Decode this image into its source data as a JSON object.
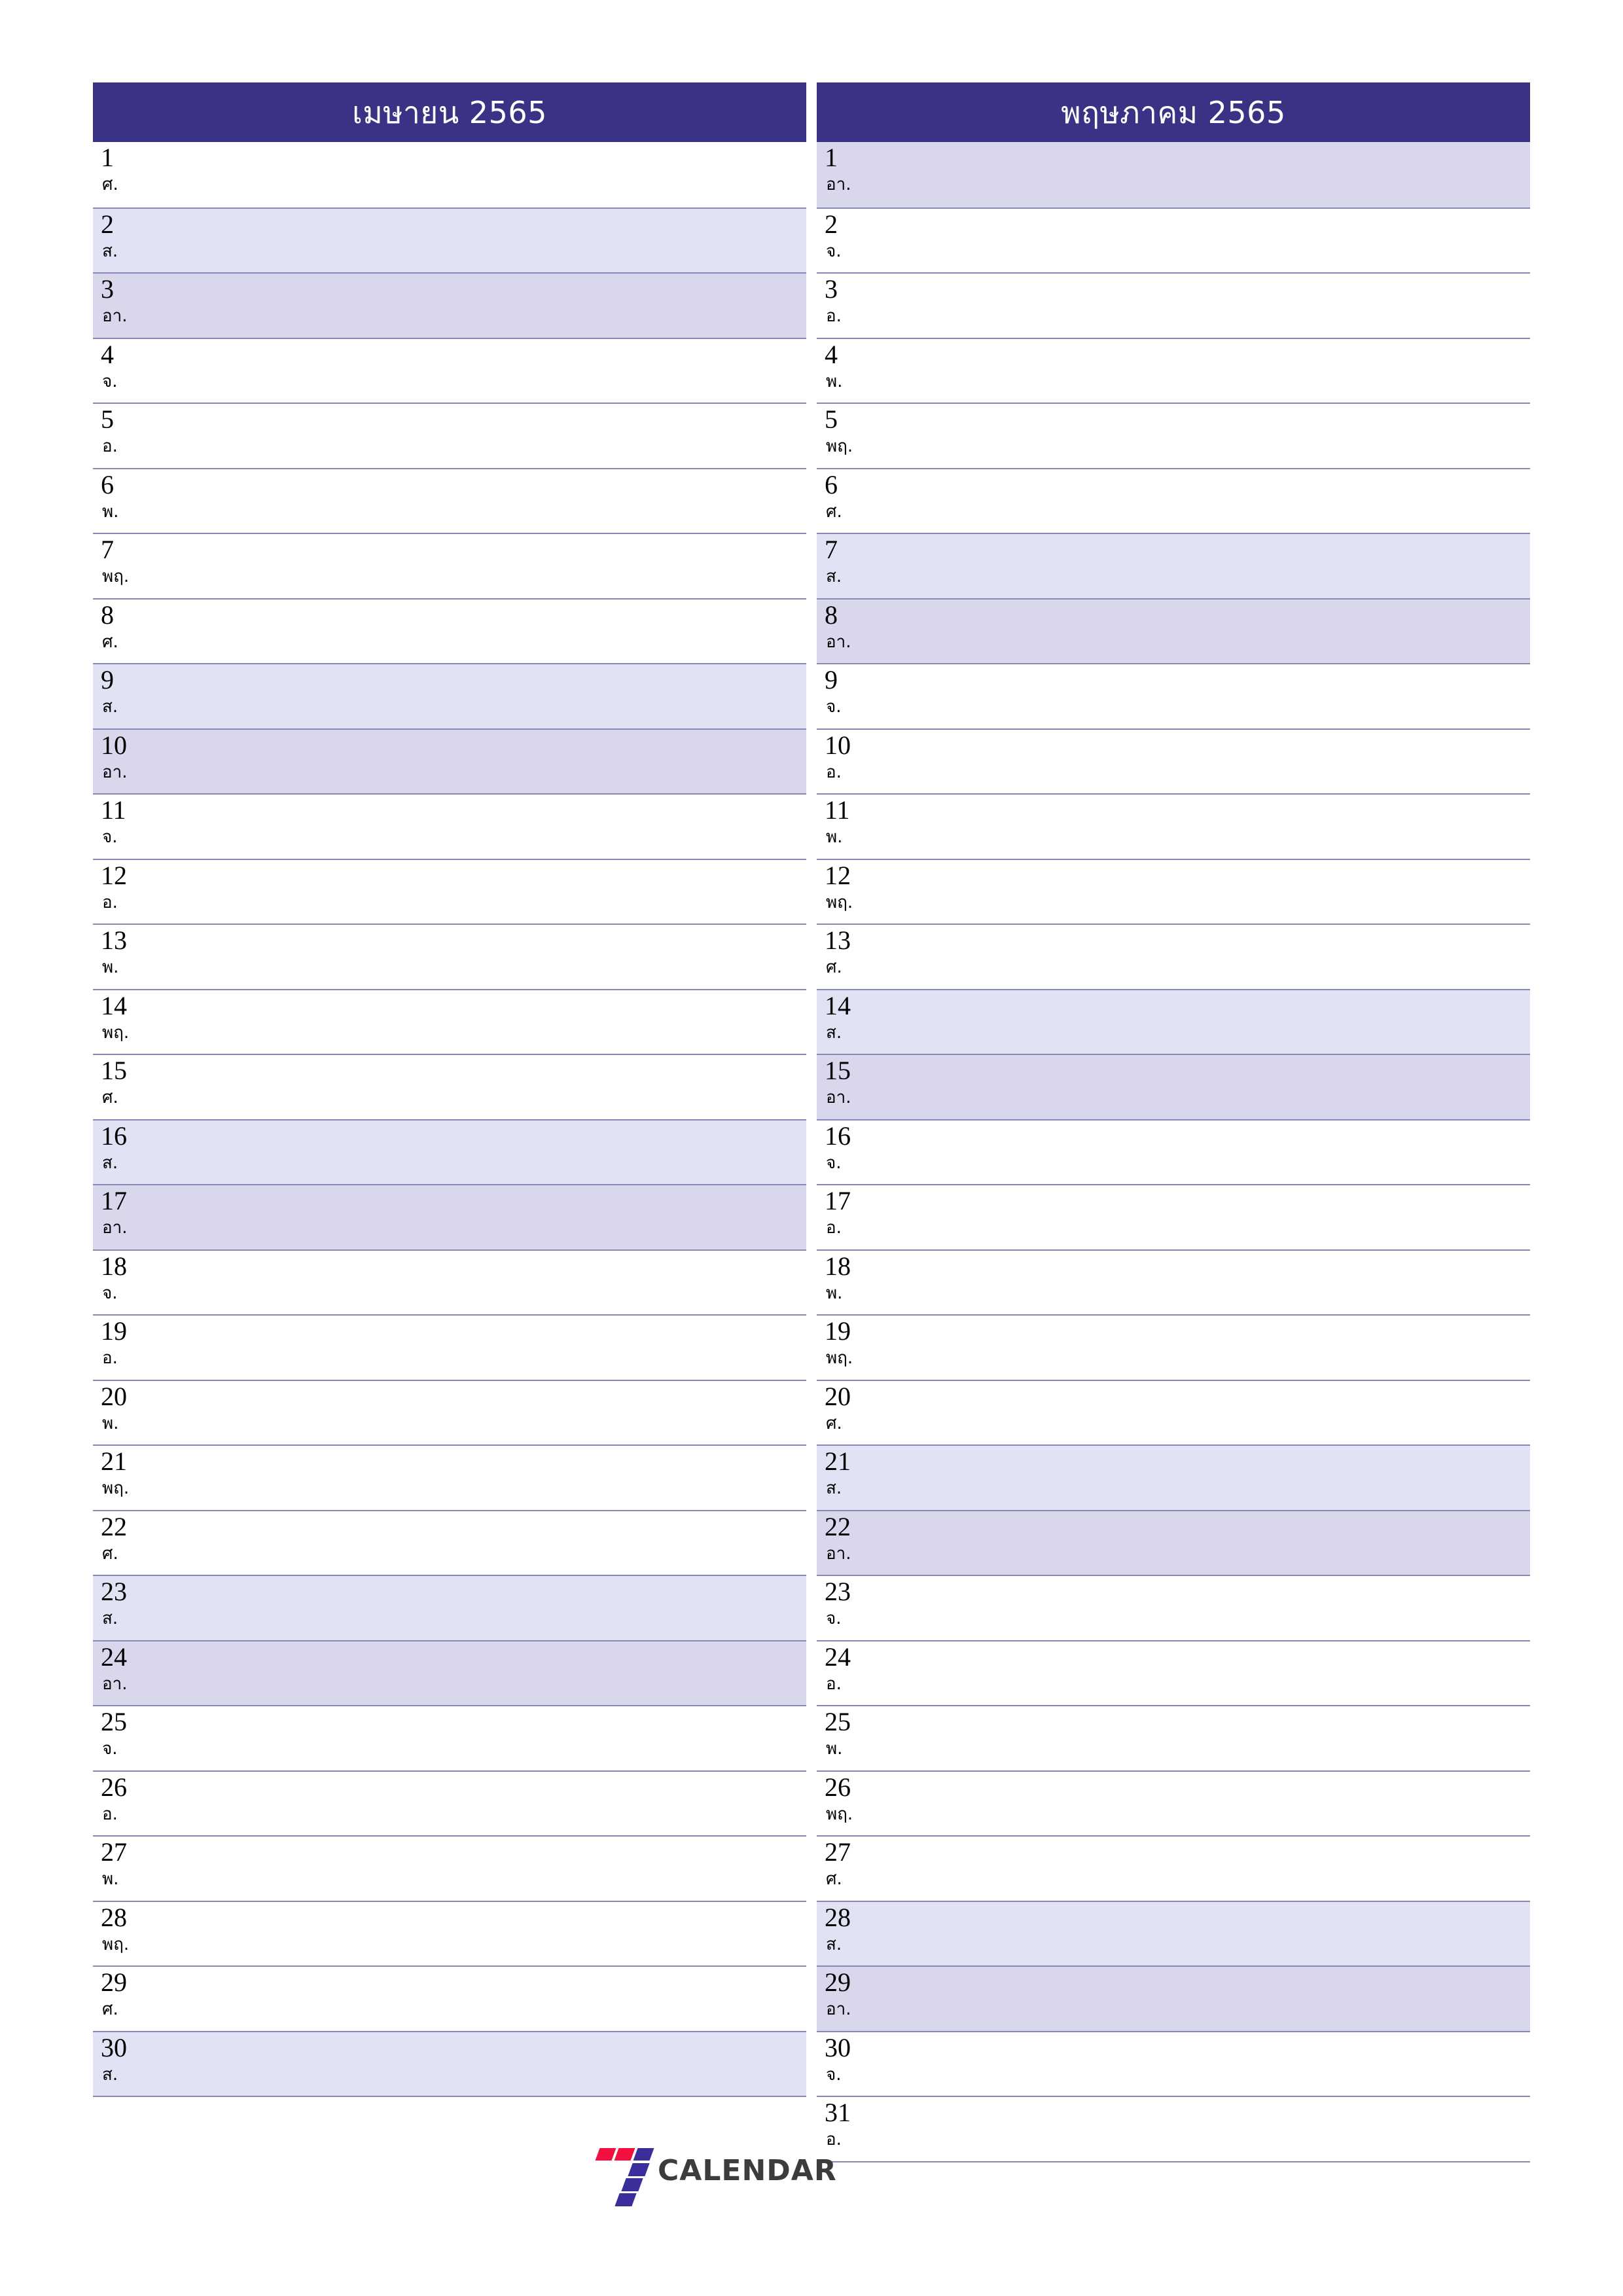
{
  "document": {
    "type": "monthly-planner",
    "orientation": "portrait",
    "colors": {
      "header_background": "#3a3285",
      "header_text": "#ffffff",
      "saturday_row": "#e2e2f5",
      "sunday_row": "#d9d7ec",
      "row_separator": "#8b86b8",
      "page_background": "#ffffff",
      "logo_red": "#f50f3f",
      "logo_purple": "#3a2f9a",
      "logo_text": "#3c3c3c"
    }
  },
  "months": [
    {
      "title": "เมษายน 2565",
      "days": [
        {
          "num": "1",
          "name": "ศ.",
          "type": "weekday"
        },
        {
          "num": "2",
          "name": "ส.",
          "type": "saturday"
        },
        {
          "num": "3",
          "name": "อา.",
          "type": "sunday"
        },
        {
          "num": "4",
          "name": "จ.",
          "type": "weekday"
        },
        {
          "num": "5",
          "name": "อ.",
          "type": "weekday"
        },
        {
          "num": "6",
          "name": "พ.",
          "type": "weekday"
        },
        {
          "num": "7",
          "name": "พฤ.",
          "type": "weekday"
        },
        {
          "num": "8",
          "name": "ศ.",
          "type": "weekday"
        },
        {
          "num": "9",
          "name": "ส.",
          "type": "saturday"
        },
        {
          "num": "10",
          "name": "อา.",
          "type": "sunday"
        },
        {
          "num": "11",
          "name": "จ.",
          "type": "weekday"
        },
        {
          "num": "12",
          "name": "อ.",
          "type": "weekday"
        },
        {
          "num": "13",
          "name": "พ.",
          "type": "weekday"
        },
        {
          "num": "14",
          "name": "พฤ.",
          "type": "weekday"
        },
        {
          "num": "15",
          "name": "ศ.",
          "type": "weekday"
        },
        {
          "num": "16",
          "name": "ส.",
          "type": "saturday"
        },
        {
          "num": "17",
          "name": "อา.",
          "type": "sunday"
        },
        {
          "num": "18",
          "name": "จ.",
          "type": "weekday"
        },
        {
          "num": "19",
          "name": "อ.",
          "type": "weekday"
        },
        {
          "num": "20",
          "name": "พ.",
          "type": "weekday"
        },
        {
          "num": "21",
          "name": "พฤ.",
          "type": "weekday"
        },
        {
          "num": "22",
          "name": "ศ.",
          "type": "weekday"
        },
        {
          "num": "23",
          "name": "ส.",
          "type": "saturday"
        },
        {
          "num": "24",
          "name": "อา.",
          "type": "sunday"
        },
        {
          "num": "25",
          "name": "จ.",
          "type": "weekday"
        },
        {
          "num": "26",
          "name": "อ.",
          "type": "weekday"
        },
        {
          "num": "27",
          "name": "พ.",
          "type": "weekday"
        },
        {
          "num": "28",
          "name": "พฤ.",
          "type": "weekday"
        },
        {
          "num": "29",
          "name": "ศ.",
          "type": "weekday"
        },
        {
          "num": "30",
          "name": "ส.",
          "type": "saturday"
        }
      ]
    },
    {
      "title": "พฤษภาคม 2565",
      "days": [
        {
          "num": "1",
          "name": "อา.",
          "type": "sunday"
        },
        {
          "num": "2",
          "name": "จ.",
          "type": "weekday"
        },
        {
          "num": "3",
          "name": "อ.",
          "type": "weekday"
        },
        {
          "num": "4",
          "name": "พ.",
          "type": "weekday"
        },
        {
          "num": "5",
          "name": "พฤ.",
          "type": "weekday"
        },
        {
          "num": "6",
          "name": "ศ.",
          "type": "weekday"
        },
        {
          "num": "7",
          "name": "ส.",
          "type": "saturday"
        },
        {
          "num": "8",
          "name": "อา.",
          "type": "sunday"
        },
        {
          "num": "9",
          "name": "จ.",
          "type": "weekday"
        },
        {
          "num": "10",
          "name": "อ.",
          "type": "weekday"
        },
        {
          "num": "11",
          "name": "พ.",
          "type": "weekday"
        },
        {
          "num": "12",
          "name": "พฤ.",
          "type": "weekday"
        },
        {
          "num": "13",
          "name": "ศ.",
          "type": "weekday"
        },
        {
          "num": "14",
          "name": "ส.",
          "type": "saturday"
        },
        {
          "num": "15",
          "name": "อา.",
          "type": "sunday"
        },
        {
          "num": "16",
          "name": "จ.",
          "type": "weekday"
        },
        {
          "num": "17",
          "name": "อ.",
          "type": "weekday"
        },
        {
          "num": "18",
          "name": "พ.",
          "type": "weekday"
        },
        {
          "num": "19",
          "name": "พฤ.",
          "type": "weekday"
        },
        {
          "num": "20",
          "name": "ศ.",
          "type": "weekday"
        },
        {
          "num": "21",
          "name": "ส.",
          "type": "saturday"
        },
        {
          "num": "22",
          "name": "อา.",
          "type": "sunday"
        },
        {
          "num": "23",
          "name": "จ.",
          "type": "weekday"
        },
        {
          "num": "24",
          "name": "อ.",
          "type": "weekday"
        },
        {
          "num": "25",
          "name": "พ.",
          "type": "weekday"
        },
        {
          "num": "26",
          "name": "พฤ.",
          "type": "weekday"
        },
        {
          "num": "27",
          "name": "ศ.",
          "type": "weekday"
        },
        {
          "num": "28",
          "name": "ส.",
          "type": "saturday"
        },
        {
          "num": "29",
          "name": "อา.",
          "type": "sunday"
        },
        {
          "num": "30",
          "name": "จ.",
          "type": "weekday"
        },
        {
          "num": "31",
          "name": "อ.",
          "type": "weekday"
        }
      ]
    }
  ],
  "logo": {
    "text": "CALENDAR",
    "mark": "seven-stripes-logo"
  }
}
